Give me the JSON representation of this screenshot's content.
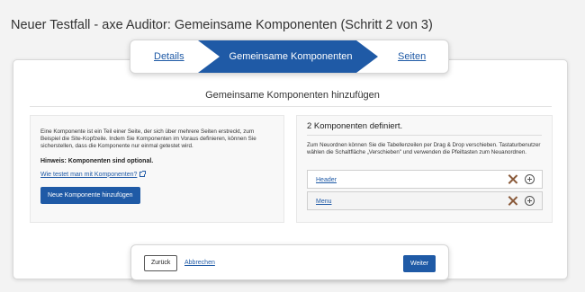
{
  "page": {
    "title": "Neuer Testfall - axe Auditor: Gemeinsame Komponenten (Schritt 2 von 3)"
  },
  "stepper": {
    "prev": "Details",
    "current": "Gemeinsame Komponenten",
    "next": "Seiten"
  },
  "section": {
    "title": "Gemeinsame Komponenten hinzufügen"
  },
  "left_panel": {
    "description": "Eine Komponente ist ein Teil einer Seite, der sich über mehrere Seiten erstreckt, zum Beispiel die Site-Kopfzeile. Indem Sie Komponenten im Voraus definieren, können Sie sicherstellen, dass die Komponente nur einmal getestet wird.",
    "hint": "Hinweis: Komponenten sind optional.",
    "help_link": "Wie testet man mit Komponenten?",
    "add_button": "Neue Komponente hinzufügen"
  },
  "right_panel": {
    "count_title": "2 Komponenten definiert.",
    "instructions": "Zum Neuordnen können Sie die Tabellenzeilen per Drag & Drop verschieben. Tastaturbenutzer wählen die Schaltfläche „Verschieben\" und verwenden die Pfeiltasten zum Neuanordnen.",
    "components": [
      {
        "name": "Header"
      },
      {
        "name": "Menu"
      }
    ]
  },
  "footer": {
    "back": "Zurück",
    "cancel": "Abbrechen",
    "next": "Weiter"
  },
  "colors": {
    "accent": "#1f5aa6",
    "delete": "#8a5a3a"
  },
  "icons": {
    "external_link": "external-link-icon",
    "delete": "delete-icon",
    "drag": "drag-move-icon"
  }
}
